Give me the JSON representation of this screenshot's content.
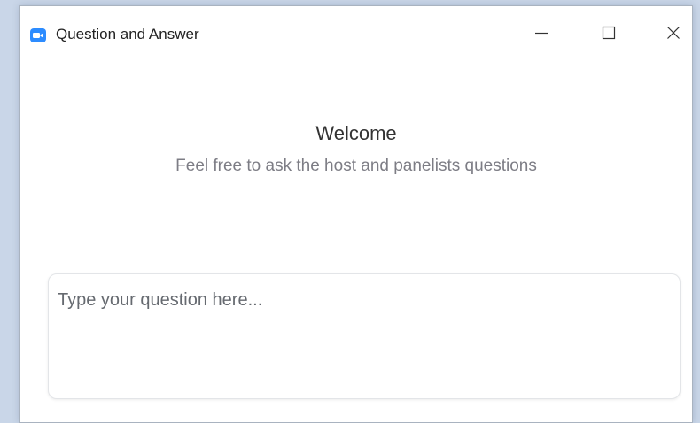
{
  "window": {
    "title": "Question and Answer",
    "app_icon": "zoom-video-icon",
    "controls": [
      "minimize-icon",
      "maximize-icon",
      "close-icon"
    ]
  },
  "main": {
    "welcome_heading": "Welcome",
    "welcome_subtitle": "Feel free to ask the host and panelists questions"
  },
  "question_input": {
    "value": "",
    "placeholder": "Type your question here..."
  },
  "colors": {
    "accent": "#2d8cff",
    "background": "#c9d6e8",
    "text_primary": "#333333",
    "text_secondary": "#7d7d85"
  }
}
